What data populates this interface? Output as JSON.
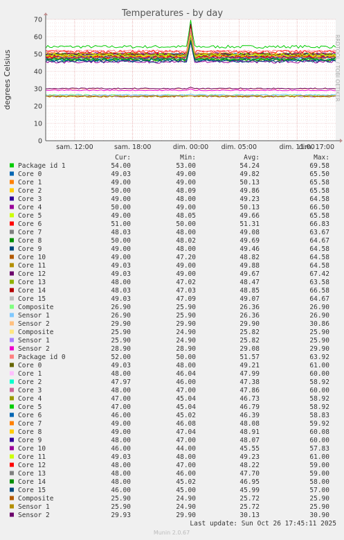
{
  "chart_data": {
    "type": "line",
    "title": "Temperatures - by day",
    "ylabel": "degrees Celsius",
    "ylim": [
      0,
      70
    ],
    "yticks": [
      0,
      10,
      20,
      30,
      40,
      50,
      60,
      70
    ],
    "xlim": [
      0,
      30
    ],
    "xticks": [
      {
        "label": "sam. 12:00",
        "x": 3
      },
      {
        "label": "sam. 18:00",
        "x": 9
      },
      {
        "label": "dim. 00:00",
        "x": 15
      },
      {
        "label": "dim. 05:00",
        "x": 20
      },
      {
        "label": "dim. 11:00",
        "x": 26
      },
      {
        "label": "dim. 17:00",
        "x": 32
      }
    ],
    "columns": [
      "Cur:",
      "Min:",
      "Avg:",
      "Max:"
    ],
    "series": [
      {
        "name": "Package id 1",
        "color": "#00cc00",
        "cur": "54.00",
        "min": "53.00",
        "avg": "54.24",
        "max": "69.58"
      },
      {
        "name": "Core 0",
        "color": "#0066b3",
        "cur": "49.03",
        "min": "49.00",
        "avg": "49.82",
        "max": "65.50"
      },
      {
        "name": "Core 1",
        "color": "#ff8000",
        "cur": "49.00",
        "min": "49.00",
        "avg": "50.13",
        "max": "65.58"
      },
      {
        "name": "Core 2",
        "color": "#ffcc00",
        "cur": "50.00",
        "min": "48.09",
        "avg": "49.86",
        "max": "65.58"
      },
      {
        "name": "Core 3",
        "color": "#330099",
        "cur": "49.00",
        "min": "48.00",
        "avg": "49.23",
        "max": "64.58"
      },
      {
        "name": "Core 4",
        "color": "#990099",
        "cur": "50.00",
        "min": "49.00",
        "avg": "50.13",
        "max": "66.50"
      },
      {
        "name": "Core 5",
        "color": "#ccff00",
        "cur": "49.00",
        "min": "48.05",
        "avg": "49.66",
        "max": "65.58"
      },
      {
        "name": "Core 6",
        "color": "#ff0000",
        "cur": "51.00",
        "min": "50.00",
        "avg": "51.31",
        "max": "66.83"
      },
      {
        "name": "Core 7",
        "color": "#808080",
        "cur": "48.03",
        "min": "48.00",
        "avg": "49.08",
        "max": "63.67"
      },
      {
        "name": "Core 8",
        "color": "#008f00",
        "cur": "50.00",
        "min": "48.02",
        "avg": "49.69",
        "max": "64.67"
      },
      {
        "name": "Core 9",
        "color": "#00487d",
        "cur": "49.00",
        "min": "48.00",
        "avg": "49.46",
        "max": "64.58"
      },
      {
        "name": "Core 10",
        "color": "#b35a00",
        "cur": "49.00",
        "min": "47.20",
        "avg": "48.82",
        "max": "64.58"
      },
      {
        "name": "Core 11",
        "color": "#b38f00",
        "cur": "49.03",
        "min": "49.00",
        "avg": "49.88",
        "max": "64.58"
      },
      {
        "name": "Core 12",
        "color": "#6b006b",
        "cur": "49.03",
        "min": "49.00",
        "avg": "49.67",
        "max": "67.42"
      },
      {
        "name": "Core 13",
        "color": "#8fb300",
        "cur": "48.00",
        "min": "47.02",
        "avg": "48.47",
        "max": "63.58"
      },
      {
        "name": "Core 14",
        "color": "#b30000",
        "cur": "48.03",
        "min": "47.03",
        "avg": "48.85",
        "max": "66.58"
      },
      {
        "name": "Core 15",
        "color": "#bebebe",
        "cur": "49.03",
        "min": "47.09",
        "avg": "49.07",
        "max": "64.67"
      },
      {
        "name": "Composite",
        "color": "#80ff80",
        "cur": "26.90",
        "min": "25.90",
        "avg": "26.36",
        "max": "26.90"
      },
      {
        "name": "Sensor 1",
        "color": "#80c9ff",
        "cur": "26.90",
        "min": "25.90",
        "avg": "26.36",
        "max": "26.90"
      },
      {
        "name": "Sensor 2",
        "color": "#ffc080",
        "cur": "29.90",
        "min": "29.90",
        "avg": "29.90",
        "max": "30.86"
      },
      {
        "name": "Composite",
        "color": "#ffe680",
        "cur": "25.90",
        "min": "24.90",
        "avg": "25.82",
        "max": "25.90"
      },
      {
        "name": "Sensor 1",
        "color": "#aa80ff",
        "cur": "25.90",
        "min": "24.90",
        "avg": "25.82",
        "max": "25.90"
      },
      {
        "name": "Sensor 2",
        "color": "#ee00cc",
        "cur": "28.90",
        "min": "28.90",
        "avg": "29.08",
        "max": "29.90"
      },
      {
        "name": "Package id 0",
        "color": "#ff8080",
        "cur": "52.00",
        "min": "50.00",
        "avg": "51.57",
        "max": "63.92"
      },
      {
        "name": "Core 0",
        "color": "#666600",
        "cur": "49.03",
        "min": "48.00",
        "avg": "49.21",
        "max": "61.00"
      },
      {
        "name": "Core 1",
        "color": "#ffbfff",
        "cur": "48.00",
        "min": "46.04",
        "avg": "47.99",
        "max": "60.00"
      },
      {
        "name": "Core 2",
        "color": "#00ffcc",
        "cur": "47.97",
        "min": "46.00",
        "avg": "47.38",
        "max": "58.92"
      },
      {
        "name": "Core 3",
        "color": "#cc6699",
        "cur": "48.00",
        "min": "47.00",
        "avg": "47.86",
        "max": "60.00"
      },
      {
        "name": "Core 4",
        "color": "#999900",
        "cur": "47.00",
        "min": "45.04",
        "avg": "46.73",
        "max": "58.92"
      },
      {
        "name": "Core 5",
        "color": "#00cc00",
        "cur": "47.00",
        "min": "45.04",
        "avg": "46.79",
        "max": "58.92"
      },
      {
        "name": "Core 6",
        "color": "#0066b3",
        "cur": "46.00",
        "min": "45.02",
        "avg": "46.39",
        "max": "58.83"
      },
      {
        "name": "Core 7",
        "color": "#ff8000",
        "cur": "49.00",
        "min": "46.08",
        "avg": "48.08",
        "max": "59.92"
      },
      {
        "name": "Core 8",
        "color": "#ffcc00",
        "cur": "49.00",
        "min": "47.04",
        "avg": "48.91",
        "max": "60.08"
      },
      {
        "name": "Core 9",
        "color": "#330099",
        "cur": "48.00",
        "min": "47.00",
        "avg": "48.07",
        "max": "60.00"
      },
      {
        "name": "Core 10",
        "color": "#990099",
        "cur": "46.00",
        "min": "44.00",
        "avg": "45.55",
        "max": "57.83"
      },
      {
        "name": "Core 11",
        "color": "#ccff00",
        "cur": "49.03",
        "min": "48.00",
        "avg": "49.23",
        "max": "61.00"
      },
      {
        "name": "Core 12",
        "color": "#ff0000",
        "cur": "48.00",
        "min": "47.00",
        "avg": "48.22",
        "max": "59.00"
      },
      {
        "name": "Core 13",
        "color": "#808080",
        "cur": "48.00",
        "min": "46.00",
        "avg": "47.70",
        "max": "59.00"
      },
      {
        "name": "Core 14",
        "color": "#008f00",
        "cur": "48.00",
        "min": "45.02",
        "avg": "46.95",
        "max": "58.00"
      },
      {
        "name": "Core 15",
        "color": "#00487d",
        "cur": "46.00",
        "min": "45.00",
        "avg": "45.99",
        "max": "57.00"
      },
      {
        "name": "Composite",
        "color": "#b35a00",
        "cur": "25.90",
        "min": "24.90",
        "avg": "25.72",
        "max": "25.90"
      },
      {
        "name": "Sensor 1",
        "color": "#b38f00",
        "cur": "25.90",
        "min": "24.90",
        "avg": "25.72",
        "max": "25.90"
      },
      {
        "name": "Sensor 2",
        "color": "#6b006b",
        "cur": "29.93",
        "min": "29.90",
        "avg": "30.13",
        "max": "30.90"
      }
    ]
  },
  "footer": {
    "last_update": "Last update: Sun Oct 26 17:45:11 2025",
    "munin_version": "Munin 2.0.67"
  },
  "watermark": "RRDTOOL / TOBI OETIKER"
}
